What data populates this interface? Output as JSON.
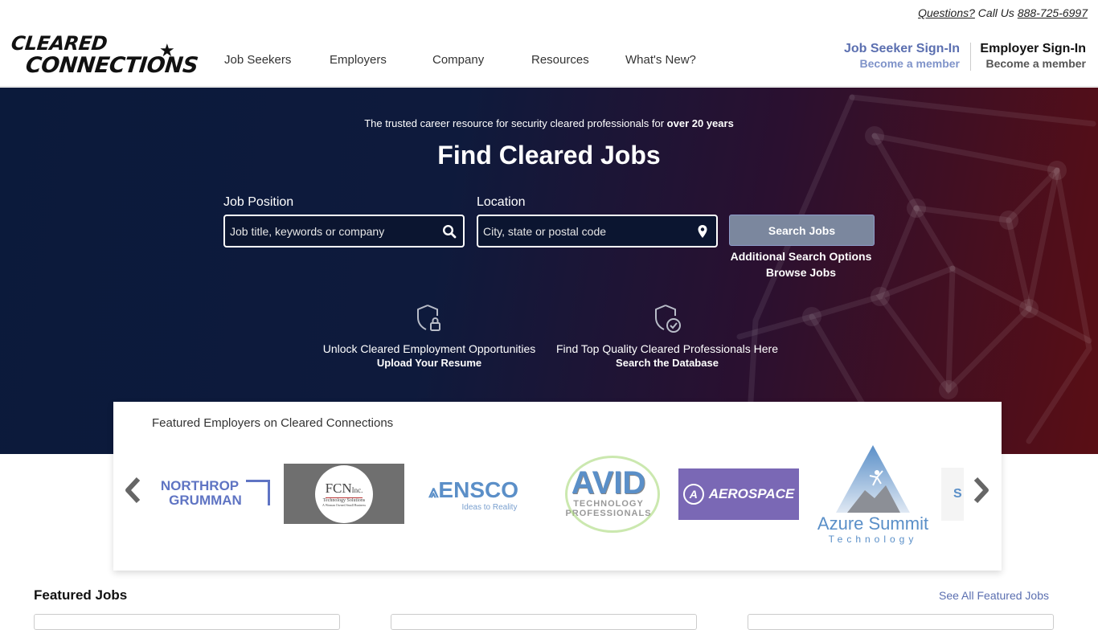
{
  "header": {
    "questions_label": "Questions?",
    "call_label": "Call Us",
    "phone": "888-725-6997",
    "logo_line1": "Cleared",
    "logo_line2": "Connections",
    "nav": [
      "Job Seekers",
      "Employers",
      "Company",
      "Resources",
      "What's New?"
    ],
    "job_seeker_signin": "Job Seeker Sign-In",
    "job_seeker_become": "Become a member",
    "employer_signin": "Employer Sign-In",
    "employer_become": "Become a member"
  },
  "hero": {
    "tagline_prefix": "The trusted career resource for security cleared professionals for",
    "tagline_bold": "over 20 years",
    "title": "Find Cleared Jobs",
    "job_label": "Job Position",
    "job_placeholder": "Job title, keywords or company",
    "job_value": "",
    "location_label": "Location",
    "location_placeholder": "City, state or postal code",
    "location_value": "",
    "search_button": "Search Jobs",
    "additional_options": "Additional Search Options",
    "browse_jobs": "Browse Jobs",
    "promos": [
      {
        "icon": "shield-lock-icon",
        "text": "Unlock Cleared Employment Opportunities",
        "link": "Upload Your Resume"
      },
      {
        "icon": "shield-check-icon",
        "text": "Find Top Quality Cleared Professionals Here",
        "link": "Search the Database"
      }
    ],
    "colors": {
      "gradient_start": "#0b1a3b",
      "gradient_end": "#5a0e14",
      "button": "#7b879e"
    }
  },
  "employers": {
    "title": "Featured Employers on Cleared Connections",
    "logos": [
      {
        "name": "Northrop Grumman",
        "line1": "NORTHROP",
        "line2": "GRUMMAN"
      },
      {
        "name": "FCN Inc.",
        "line1": "FCN",
        "sup": "Inc.",
        "line2": "Technology Solutions",
        "line3": "A Woman Owned Small Business"
      },
      {
        "name": "ENSCO",
        "line1": "ENSCO",
        "line2": "Ideas to Reality"
      },
      {
        "name": "AVID Technology Professionals",
        "line1": "AVID",
        "line2": "TECHNOLOGY",
        "line3": "PROFESSIONALS"
      },
      {
        "name": "Aerospace",
        "line1": "AEROSPACE"
      },
      {
        "name": "Azure Summit Technology",
        "line1": "Azure Summit",
        "line2": "Technology"
      },
      {
        "name": "partial-logo",
        "line1": "S"
      }
    ]
  },
  "featured_jobs": {
    "title": "Featured Jobs",
    "see_all": "See All Featured Jobs"
  }
}
